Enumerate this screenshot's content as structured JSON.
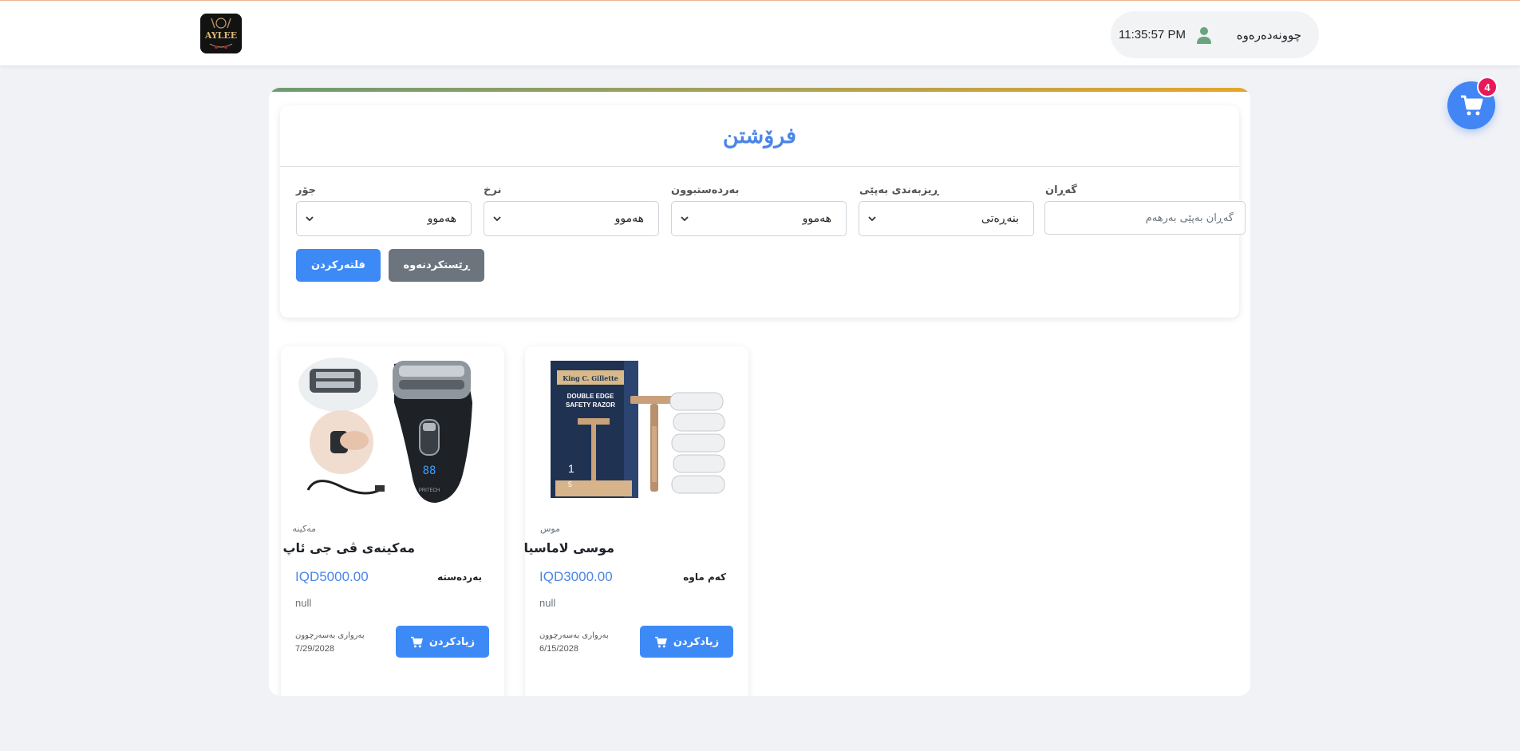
{
  "header": {
    "logo_text": "AYLEE",
    "time": "11:35:57 PM",
    "logout_label": "چوونەدەرەوە"
  },
  "cart": {
    "count": "4"
  },
  "page": {
    "title": "فرۆشتن",
    "filters": {
      "search": {
        "label": "گەڕان",
        "placeholder": "گەڕان بەپێی بەرهەم"
      },
      "sort": {
        "label": "ڕیزبەندی بەپێی",
        "value": "بنەڕەتی"
      },
      "availability": {
        "label": "بەردەستبوون",
        "value": "هەموو"
      },
      "price": {
        "label": "نرخ",
        "value": "هەموو"
      },
      "type": {
        "label": "جۆر",
        "value": "هەموو"
      }
    },
    "buttons": {
      "reset": "ڕێستکردنەوە",
      "filter": "فلتەرکردن"
    }
  },
  "products": [
    {
      "category": "مەکینە",
      "name": "مەکینەی ڤی جی ئاپ",
      "price": "IQD5000.00",
      "stock": "بەردەستە",
      "description": "null",
      "expiry_label": "بەرواری بەسەرچوون",
      "expiry_date": "7/29/2028",
      "add_label": "زیادکردن",
      "image": "electric-shaver"
    },
    {
      "category": "موس",
      "name": "موسی لاماسیا",
      "price": "IQD3000.00",
      "stock": "کەم ماوە",
      "description": "null",
      "expiry_label": "بەرواری بەسەرچوون",
      "expiry_date": "6/15/2028",
      "add_label": "زیادکردن",
      "image": "safety-razor-box",
      "image_texts": {
        "brand": "King C. Gillette",
        "line1": "DOUBLE EDGE",
        "line2": "SAFETY RAZOR"
      }
    }
  ],
  "colors": {
    "primary": "#3d8af7",
    "title": "#4a86e8",
    "secondary": "#6c757d",
    "badge": "#e8185b",
    "background": "#f1f2f6"
  }
}
